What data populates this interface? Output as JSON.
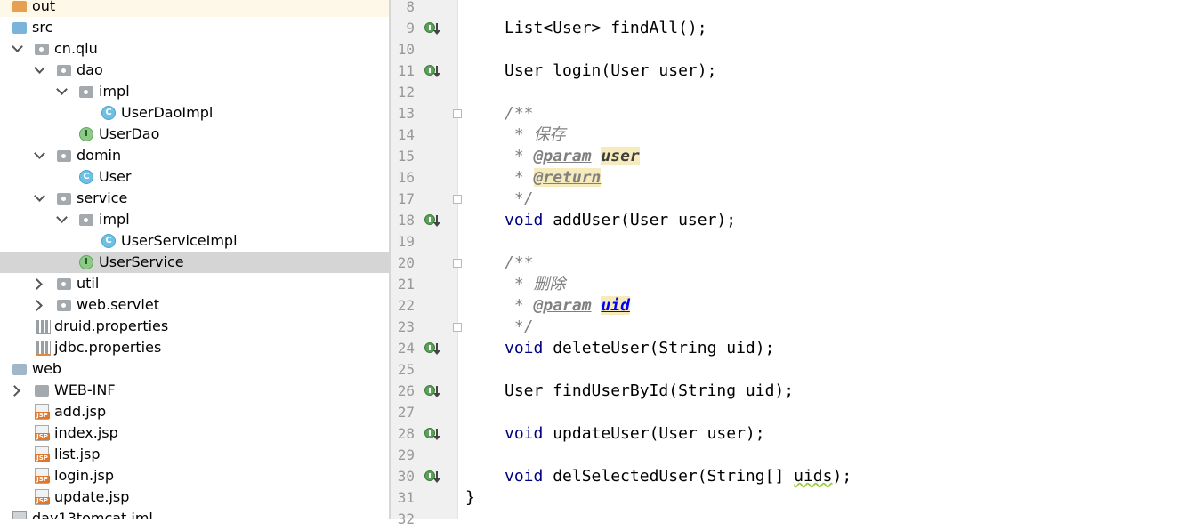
{
  "project_tree": {
    "rows": [
      {
        "label": "out",
        "icon": "folder-orange-icon",
        "depth": 0
      },
      {
        "label": "src",
        "icon": "folder-blue-icon",
        "depth": 0
      },
      {
        "label": "cn.qlu",
        "icon": "package-icon",
        "depth": 0,
        "expanded": true
      },
      {
        "label": "dao",
        "icon": "package-icon",
        "depth": 1,
        "expanded": true
      },
      {
        "label": "impl",
        "icon": "package-icon",
        "depth": 2,
        "expanded": true
      },
      {
        "label": "UserDaoImpl",
        "icon": "class-icon",
        "depth": 3
      },
      {
        "label": "UserDao",
        "icon": "interface-icon",
        "depth": 2
      },
      {
        "label": "domin",
        "icon": "package-icon",
        "depth": 1,
        "expanded": true
      },
      {
        "label": "User",
        "icon": "class-icon",
        "depth": 2
      },
      {
        "label": "service",
        "icon": "package-icon",
        "depth": 1,
        "expanded": true
      },
      {
        "label": "impl",
        "icon": "package-icon",
        "depth": 2,
        "expanded": true
      },
      {
        "label": "UserServiceImpl",
        "icon": "class-icon",
        "depth": 3
      },
      {
        "label": "UserService",
        "icon": "interface-icon",
        "depth": 2,
        "selected": true
      },
      {
        "label": "util",
        "icon": "package-icon",
        "depth": 1,
        "expanded": false
      },
      {
        "label": "web.servlet",
        "icon": "package-icon",
        "depth": 1,
        "expanded": false
      },
      {
        "label": "druid.properties",
        "icon": "properties-file-icon",
        "depth": 0
      },
      {
        "label": "jdbc.properties",
        "icon": "properties-file-icon",
        "depth": 0
      },
      {
        "label": "web",
        "icon": "web-folder-icon",
        "depth": 0
      },
      {
        "label": "WEB-INF",
        "icon": "folder-gray-icon",
        "depth": 0,
        "expanded": false
      },
      {
        "label": "add.jsp",
        "icon": "jsp-file-icon",
        "depth": 0
      },
      {
        "label": "index.jsp",
        "icon": "jsp-file-icon",
        "depth": 0
      },
      {
        "label": "list.jsp",
        "icon": "jsp-file-icon",
        "depth": 0
      },
      {
        "label": "login.jsp",
        "icon": "jsp-file-icon",
        "depth": 0
      },
      {
        "label": "update.jsp",
        "icon": "jsp-file-icon",
        "depth": 0
      },
      {
        "label": "day13tomcat.iml",
        "icon": "iml-file-icon",
        "depth": 0
      }
    ]
  },
  "editor": {
    "line_numbers": [
      "8",
      "9",
      "10",
      "11",
      "12",
      "13",
      "14",
      "15",
      "16",
      "17",
      "18",
      "19",
      "20",
      "21",
      "22",
      "23",
      "24",
      "25",
      "26",
      "27",
      "28",
      "29",
      "30",
      "31",
      "32"
    ],
    "code": {
      "l9_type": "List<User>",
      "l9_rest": " findAll();",
      "l11": "User login(User user);",
      "l13": "/**",
      "l14": " * 保存",
      "l15_star": " * ",
      "l15_tag": "@param",
      "l15_name": "user",
      "l16_star": " * ",
      "l16_tag": "@return",
      "l17": " */",
      "l18_kw": "void",
      "l18_rest": " addUser(User user);",
      "l20": "/**",
      "l21": " * 删除",
      "l22_star": " * ",
      "l22_tag": "@param",
      "l22_name": "uid",
      "l23": " */",
      "l24_kw": "void",
      "l24_rest": " deleteUser(String uid);",
      "l26": "User findUserById(String uid);",
      "l28_kw": "void",
      "l28_rest": " updateUser(User user);",
      "l30_kw": "void",
      "l30_pre": " delSelectedUser(String[] ",
      "l30_var": "uids",
      "l30_end": ");",
      "l31": "}"
    }
  },
  "colors": {
    "keyword": "#000080",
    "comment": "#808080",
    "selection": "#d5d5d5",
    "gutter": "#f0f0f0"
  }
}
